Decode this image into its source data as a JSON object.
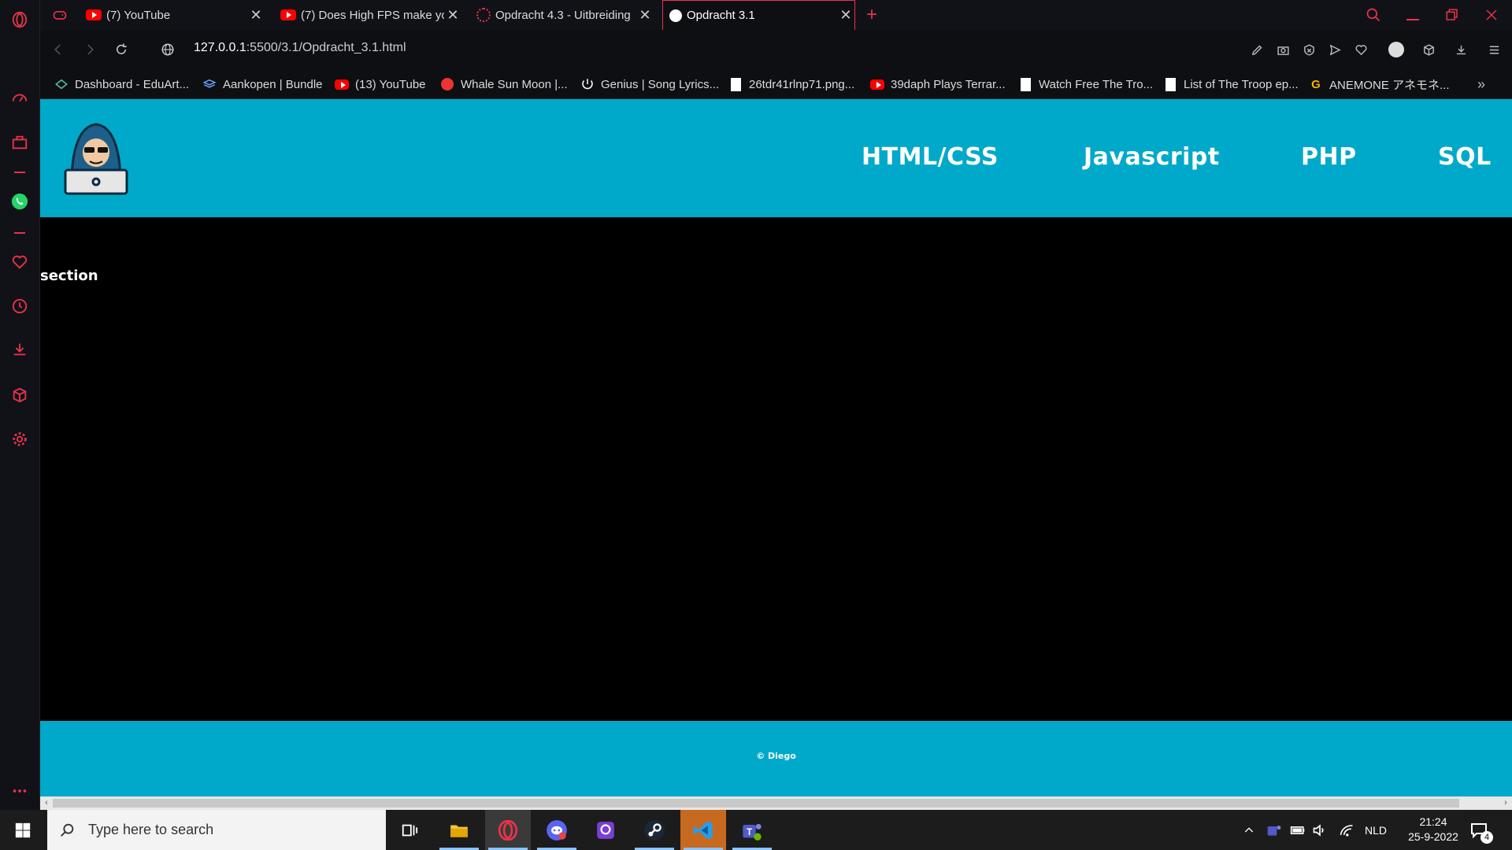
{
  "browser": {
    "tabs": [
      {
        "label": "(7) YouTube",
        "icon": "youtube-icon"
      },
      {
        "label": "(7) Does High FPS make yo",
        "icon": "youtube-icon"
      },
      {
        "label": "Opdracht 4.3 - Uitbreiding",
        "icon": "loading-icon"
      },
      {
        "label": "Opdracht 3.1",
        "icon": "globe-icon",
        "active": true
      }
    ],
    "url_host": "127.0.0.1",
    "url_path": ":5500/3.1/Opdracht_3.1.html",
    "bookmarks": [
      {
        "label": "Dashboard - EduArt...",
        "icon": "eduart-icon"
      },
      {
        "label": "Aankopen | Bundle",
        "icon": "bundle-icon"
      },
      {
        "label": "(13) YouTube",
        "icon": "youtube-icon"
      },
      {
        "label": "Whale Sun Moon |...",
        "icon": "whale-icon"
      },
      {
        "label": "Genius | Song Lyrics...",
        "icon": "genius-icon"
      },
      {
        "label": "26tdr41rlnp71.png...",
        "icon": "file-icon"
      },
      {
        "label": "39daph Plays Terrar...",
        "icon": "youtube-icon"
      },
      {
        "label": "Watch Free The Tro...",
        "icon": "file-icon"
      },
      {
        "label": "List of The Troop ep...",
        "icon": "file-icon"
      },
      {
        "label": "ANEMONE アネモネ...",
        "icon": "google-icon"
      }
    ],
    "accent_color": "#e8334a"
  },
  "site": {
    "nav": [
      "HTML/CSS",
      "Javascript",
      "PHP",
      "SQL"
    ],
    "section_text": "section",
    "footer_text": "© Diego",
    "header_color": "#00a9c9"
  },
  "taskbar": {
    "search_placeholder": "Type here to search",
    "language": "NLD",
    "time": "21:24",
    "date": "25-9-2022",
    "notification_count": "4"
  }
}
